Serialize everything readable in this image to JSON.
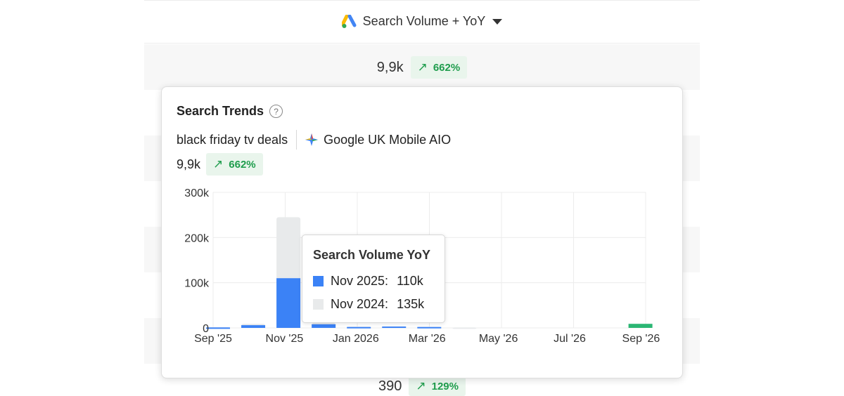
{
  "colors": {
    "current_bar": "#3b82f6",
    "prior_bar": "#e8eaeb",
    "highlight_bar": "#2bb673",
    "positive_text": "#1f9d4d",
    "badge_bg": "#e9f5ec"
  },
  "column_header": {
    "icon": "google-ads-icon",
    "title": "Search Volume + YoY",
    "dropdown_icon": "caret-down-icon"
  },
  "rows": [
    {
      "volume": "9,9k",
      "yoy": "662%",
      "arrow": "↗"
    },
    {
      "volume": "390",
      "yoy": "129%",
      "arrow": "↗"
    }
  ],
  "popup": {
    "title": "Search Trends",
    "help_icon": "question-mark-icon",
    "help_glyph": "?",
    "keyword": "black friday tv deals",
    "source_icon": "gemini-sparkle-icon",
    "source": "Google UK Mobile AIO",
    "volume": "9,9k",
    "yoy": "662%",
    "arrow": "↗"
  },
  "tooltip": {
    "title": "Search Volume YoY",
    "rows": [
      {
        "label": "Nov 2025:",
        "value": "110k",
        "color": "#3b82f6"
      },
      {
        "label": "Nov 2024:",
        "value": "135k",
        "color": "#e8eaeb"
      }
    ]
  },
  "chart_data": {
    "type": "bar",
    "title": "",
    "ylim": [
      0,
      300000
    ],
    "y_ticks": [
      "0",
      "100k",
      "200k",
      "300k"
    ],
    "x_tick_labels": [
      "Sep '25",
      "Nov '25",
      "Jan 2026",
      "Mar '26",
      "May '26",
      "Jul '26",
      "Sep '26"
    ],
    "categories": [
      "Sep '25",
      "Oct '25",
      "Nov '25",
      "Dec '25",
      "Jan 2026",
      "Feb '26",
      "Mar '26",
      "Apr '26",
      "May '26",
      "Jun '26",
      "Jul '26",
      "Aug '26",
      "Sep '26"
    ],
    "series": [
      {
        "name": "Nov 2025",
        "role": "current",
        "values": [
          1000,
          6000,
          110000,
          8000,
          2000,
          3000,
          2000,
          0,
          0,
          0,
          0,
          0,
          9000
        ]
      },
      {
        "name": "Nov 2024",
        "role": "prior",
        "values": [
          1500,
          9000,
          245000,
          11000,
          3000,
          3000,
          2500,
          1000,
          0,
          0,
          0,
          0,
          0
        ]
      }
    ],
    "highlight_index": 12,
    "grid": true,
    "legend": "none"
  }
}
